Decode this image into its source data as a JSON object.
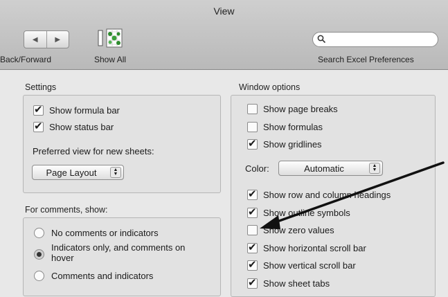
{
  "window": {
    "title": "View"
  },
  "toolbar": {
    "back_forward_label": "Back/Forward",
    "show_all_label": "Show All",
    "search_label": "Search Excel Preferences",
    "search_value": ""
  },
  "settings": {
    "heading": "Settings",
    "show_formula_bar": {
      "label": "Show formula bar",
      "checked": true
    },
    "show_status_bar": {
      "label": "Show status bar",
      "checked": true
    },
    "preferred_view_label": "Preferred view for new sheets:",
    "preferred_view_value": "Page Layout"
  },
  "comments": {
    "heading": "For comments, show:",
    "options": [
      {
        "label": "No comments or indicators",
        "selected": false
      },
      {
        "label": "Indicators only, and comments on",
        "label2": "hover",
        "selected": true
      },
      {
        "label": "Comments and indicators",
        "selected": false
      }
    ]
  },
  "window_options": {
    "heading": "Window options",
    "color_label": "Color:",
    "color_value": "Automatic",
    "items": [
      {
        "label": "Show page breaks",
        "checked": false
      },
      {
        "label": "Show formulas",
        "checked": false
      },
      {
        "label": "Show gridlines",
        "checked": true
      },
      {
        "label": "Show row and column headings",
        "checked": true
      },
      {
        "label": "Show outline symbols",
        "checked": true
      },
      {
        "label": "Show zero values",
        "checked": false
      },
      {
        "label": "Show horizontal scroll bar",
        "checked": true
      },
      {
        "label": "Show vertical scroll bar",
        "checked": true
      },
      {
        "label": "Show sheet tabs",
        "checked": true
      }
    ]
  },
  "colors": {
    "annotation_arrow": "#111111"
  }
}
